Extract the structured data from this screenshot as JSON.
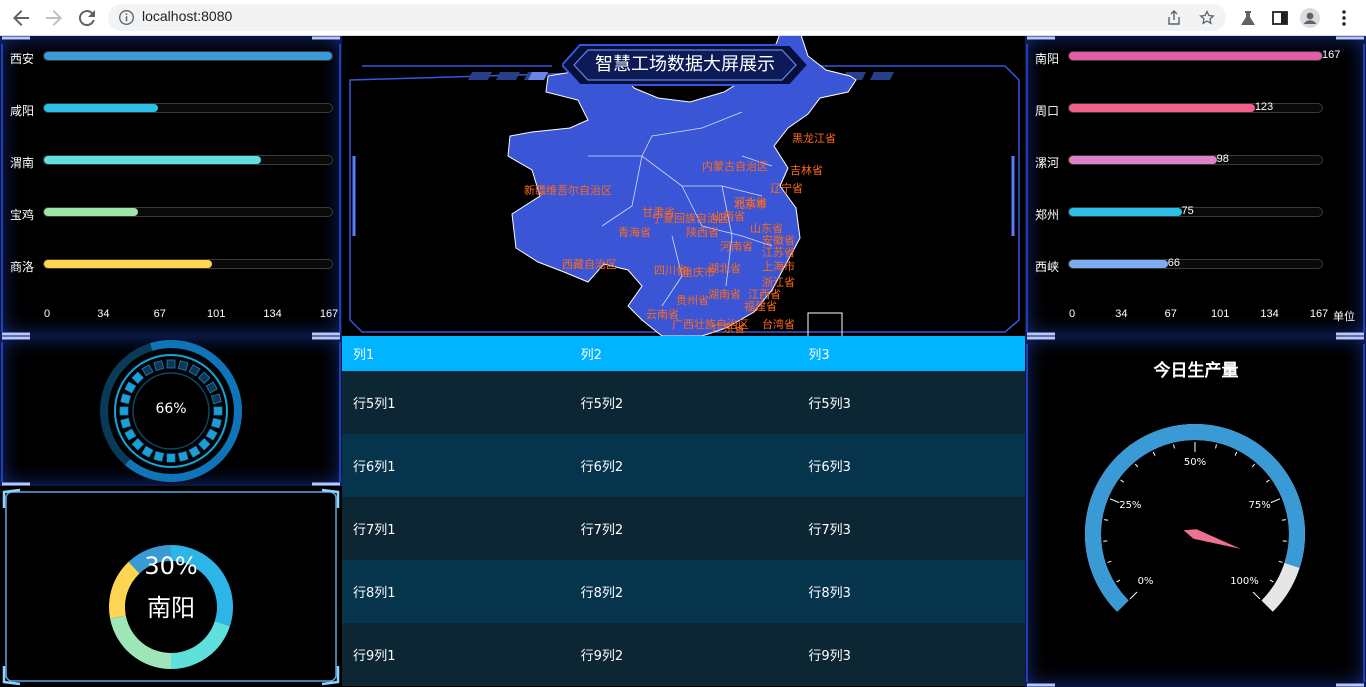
{
  "browser": {
    "url": "localhost:8080"
  },
  "dashboard": {
    "title": "智慧工场数据大屏展示",
    "left_bars": {
      "items": [
        {
          "label": "西安",
          "value": 167,
          "color": "#3b9bd9"
        },
        {
          "label": "咸阳",
          "value": 67,
          "color": "#2cc0e8"
        },
        {
          "label": "渭南",
          "value": 126,
          "color": "#5ee0dc"
        },
        {
          "label": "宝鸡",
          "value": 55,
          "color": "#9ee6a8"
        },
        {
          "label": "商洛",
          "value": 98,
          "color": "#fdd550"
        }
      ],
      "ticks": [
        "0",
        "34",
        "67",
        "101",
        "134",
        "167"
      ],
      "max": 167
    },
    "right_bars": {
      "items": [
        {
          "label": "南阳",
          "value": 167,
          "value_text": "167",
          "color": "#e05fa8"
        },
        {
          "label": "周口",
          "value": 123,
          "value_text": "123",
          "color": "#f0608a"
        },
        {
          "label": "漯河",
          "value": 98,
          "value_text": "98",
          "color": "#e07ec7"
        },
        {
          "label": "郑州",
          "value": 75,
          "value_text": "75",
          "color": "#2cc0e8"
        },
        {
          "label": "西峡",
          "value": 66,
          "value_text": "66",
          "color": "#7eaaf0"
        }
      ],
      "ticks": [
        "0",
        "34",
        "67",
        "101",
        "134",
        "167"
      ],
      "unit": "单位",
      "max": 167
    },
    "ring_progress": {
      "value_text": "66%",
      "value": 0.66
    },
    "donut": {
      "percent_text": "30%",
      "label": "南阳",
      "segments": [
        {
          "value": 30,
          "color": "#2cb5e6"
        },
        {
          "value": 20,
          "color": "#5ee0dc"
        },
        {
          "value": 22,
          "color": "#9ee6b8"
        },
        {
          "value": 16,
          "color": "#fdd550"
        },
        {
          "value": 12,
          "color": "#3a9ad6"
        }
      ]
    },
    "table": {
      "headers": [
        "列1",
        "列2",
        "列3"
      ],
      "rows": [
        [
          "行5列1",
          "行5列2",
          "行5列3"
        ],
        [
          "行6列1",
          "行6列2",
          "行6列3"
        ],
        [
          "行7列1",
          "行7列2",
          "行7列3"
        ],
        [
          "行8列1",
          "行8列2",
          "行8列3"
        ],
        [
          "行9列1",
          "行9列2",
          "行9列3"
        ]
      ]
    },
    "gauge": {
      "title": "今日生产量",
      "labels": [
        "0%",
        "25%",
        "50%",
        "75%",
        "100%"
      ],
      "value": 0.9,
      "colors": {
        "fill": "#3a9ad6",
        "rest": "#e6e6e6",
        "pointer": "#f07090"
      }
    },
    "map": {
      "fill": "#3a55d6",
      "labels": [
        "新疆维吾尔自治区",
        "西藏自治区",
        "青海省",
        "内蒙古自治区",
        "黑龙江省",
        "吉林省",
        "辽宁省",
        "河北省",
        "甘肃省",
        "宁夏回族自治区",
        "陕西省",
        "山西省",
        "山东省",
        "河南省",
        "四川省",
        "湖北省",
        "江苏省",
        "上海市",
        "浙江省",
        "湖南省",
        "江西省",
        "贵州省",
        "福建省",
        "云南省",
        "广西壮族自治区",
        "广东省",
        "台湾省",
        "安徽省",
        "重庆市",
        "北京市"
      ]
    }
  }
}
